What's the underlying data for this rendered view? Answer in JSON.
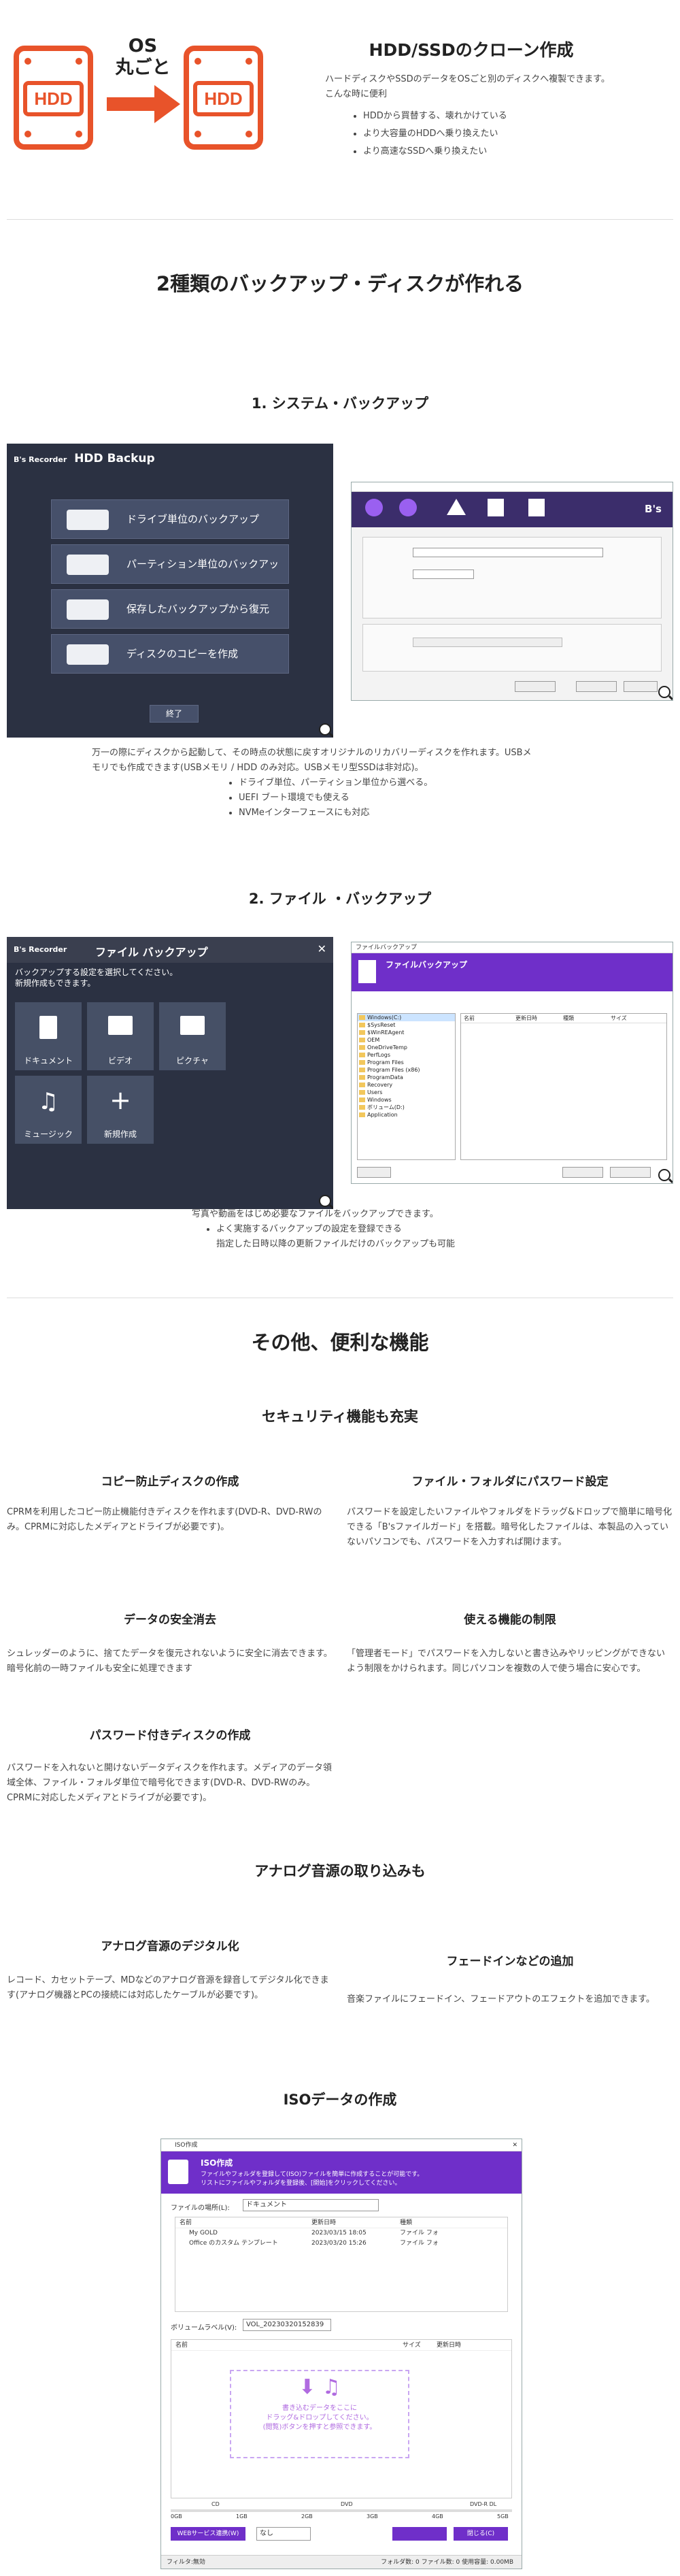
{
  "hero": {
    "os_text": "OS\n丸ごと",
    "hdd_label": "HDD",
    "title": "HDD/SSDのクローン作成",
    "desc1": "ハードディスクやSSDのデータをOSごと別のディスクへ複製できます。",
    "desc2": "こんな時に便利",
    "bullets": [
      "HDDから買替する、壊れかけている",
      "より大容量のHDDへ乗り換えたい",
      "より高速なSSDへ乗り換えたい"
    ]
  },
  "sec_backup": {
    "title": "2種類のバックアップ・ディスクが作れる",
    "system": {
      "title": "1. システム・バックアップ",
      "app_logo": "B's Recorder",
      "app_title": "HDD Backup",
      "buttons": [
        "ドライブ単位のバックアップ",
        "パーティション単位のバックアップ",
        "保存したバックアップから復元",
        "ディスクのコピーを作成"
      ],
      "close_label": "終了",
      "desc1": "万一の際にディスクから起動して、その時点の状態に戻すオリジナルのリカバリーディスクを作れます。USBメ",
      "desc2": "モリでも作成できます(USBメモリ / HDD のみ対応。USBメモリ型SSDは非対応)。",
      "bullets": [
        "ドライブ単位、パーティション単位から選べる。",
        "UEFI ブート環境でも使える",
        "NVMeインターフェースにも対応"
      ]
    },
    "file": {
      "title": "2. ファイル ・バックアップ",
      "app_logo": "B's Recorder",
      "app_title": "ファイル バックアップ",
      "prompt1": "バックアップする設定を選択してください。",
      "prompt2": "新規作成もできます。",
      "tiles": [
        "ドキュメント",
        "ビデオ",
        "ピクチャ",
        "ミュージック",
        "新規作成"
      ],
      "win_title": "ファイルバックアップ",
      "win_header": "ファイルバックアップ",
      "tree": [
        "Windows(C:)",
        "$SysReset",
        "$WinREAgent",
        "OEM",
        "OneDriveTemp",
        "PerfLogs",
        "Program Files",
        "Program Files (x86)",
        "ProgramData",
        "Recovery",
        "Users",
        "Windows",
        "ボリューム(D:)",
        "Application"
      ],
      "cols": [
        "名前",
        "更新日時",
        "種類",
        "サイズ"
      ],
      "desc": "写真や動画をはじめ必要なファイルをバックアップできます。",
      "bullet": "よく実施するバックアップの設定を登録できる",
      "sub": "指定した日時以降の更新ファイルだけのバックアップも可能"
    }
  },
  "sec_other": {
    "title": "その他、便利な機能",
    "security": {
      "title": "セキュリティ機能も充実",
      "features": [
        {
          "title": "コピー防止ディスクの作成",
          "text": "CPRMを利用したコピー防止機能付きディスクを作れます(DVD-R、DVD-RWのみ。CPRMに対応したメディアとドライブが必要です)。"
        },
        {
          "title": "ファイル・フォルダにパスワード設定",
          "text": "パスワードを設定したいファイルやフォルダをドラッグ&ドロップで簡単に暗号化できる「B'sファイルガード」を搭載。暗号化したファイルは、本製品の入っていないパソコンでも、パスワードを入力すれば開けます。"
        },
        {
          "title": "データの安全消去",
          "text": "シュレッダーのように、捨てたデータを復元されないように安全に消去できます。暗号化前の一時ファイルも安全に処理できます"
        },
        {
          "title": "使える機能の制限",
          "text": "「管理者モード」でパスワードを入力しないと書き込みやリッピングができないよう制限をかけられます。同じパソコンを複数の人で使う場合に安心です。"
        },
        {
          "title": "パスワード付きディスクの作成",
          "text": "パスワードを入れないと開けないデータディスクを作れます。メディアのデータ領域全体、ファイル・フォルダ単位で暗号化できます(DVD-R、DVD-RWのみ。CPRMに対応したメディアとドライブが必要です)。"
        }
      ]
    },
    "analog": {
      "title": "アナログ音源の取り込みも",
      "features": [
        {
          "title": "アナログ音源のデジタル化",
          "text": "レコード、カセットテープ、MDなどのアナログ音源を録音してデジタル化できます(アナログ機器とPCの接続には対応したケーブルが必要です)。"
        },
        {
          "title": "フェードインなどの追加",
          "text": "音楽ファイルにフェードイン、フェードアウトのエフェクトを追加できます。"
        }
      ]
    },
    "iso": {
      "title": "ISOデータの作成",
      "win_title": "ISO作成",
      "header": "ISO作成",
      "header_desc1": "ファイルやフォルダを登録して(ISO)ファイルを簡単に作成することが可能です。",
      "header_desc2": "リストにファイルやフォルダを登録後、[開始]をクリックしてください。",
      "location_label": "ファイルの場所(L):",
      "location_value": "ドキュメント",
      "cols": [
        "名前",
        "更新日時",
        "種類"
      ],
      "rows": [
        {
          "name": "My GOLD",
          "date": "2023/03/15 18:05",
          "type": "ファイル フォ"
        },
        {
          "name": "Office のカスタム テンプレート",
          "date": "2023/03/20 15:26",
          "type": "ファイル フォ"
        }
      ],
      "volume_label": "ボリュームラベル(V):",
      "volume_value": "VOL_20230320152839",
      "list_cols": [
        "名前",
        "サイズ",
        "更新日時"
      ],
      "drop_text1": "書き込むデータをここに",
      "drop_text2": "ドラッグ&ドロップしてください。",
      "drop_text3": "(閲覧)ボタンを押すと参照できます。",
      "scale_top": [
        "CD",
        "DVD",
        "DVD-R DL"
      ],
      "scale_bottom": [
        "0GB",
        "1GB",
        "2GB",
        "3GB",
        "4GB",
        "5GB"
      ],
      "web_btn": "WEBサービス連携(W)",
      "none_label": "なし",
      "close_btn": "閉じる(C)",
      "status_left": "フィルタ:無効",
      "status_right": "フォルダ数: 0 ファイル数: 0 使用容量: 0.00MB"
    }
  }
}
